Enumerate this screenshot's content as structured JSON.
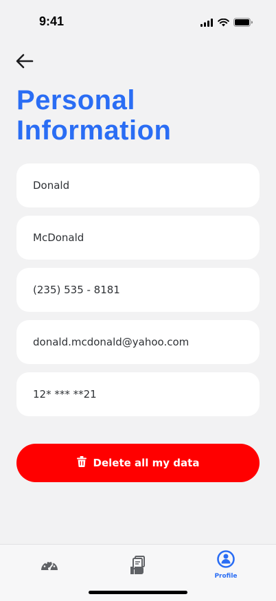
{
  "status_bar": {
    "time": "9:41",
    "icons": [
      "cellular-signal-icon",
      "wifi-icon",
      "battery-icon"
    ]
  },
  "header": {
    "back_icon": "back-arrow-icon",
    "title": "Personal Information"
  },
  "form": {
    "fields": [
      {
        "name": "first-name",
        "value": "Donald"
      },
      {
        "name": "last-name",
        "value": "McDonald"
      },
      {
        "name": "phone",
        "value": "(235) 535 - 8181"
      },
      {
        "name": "email",
        "value": "donald.mcdonald@yahoo.com"
      },
      {
        "name": "id-number",
        "value": "12* *** **21"
      }
    ]
  },
  "delete_button": {
    "label": "Delete all my data",
    "icon": "trash-icon"
  },
  "tab_bar": {
    "tabs": [
      {
        "icon": "speedometer-icon",
        "label": "",
        "active": false
      },
      {
        "icon": "documents-hand-icon",
        "label": "",
        "active": false
      },
      {
        "icon": "profile-icon",
        "label": "Profile",
        "active": true
      }
    ]
  },
  "colors": {
    "accent": "#2a6df4",
    "danger": "#ff0000",
    "background": "#f2f2f3",
    "field_background": "#ffffff"
  }
}
